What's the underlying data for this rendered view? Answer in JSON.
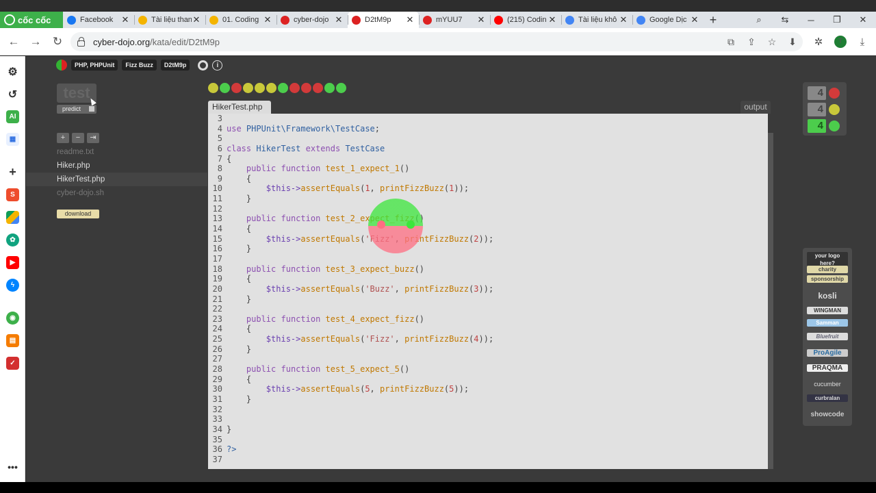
{
  "browser": {
    "brand": "cốc cốc",
    "tabs": [
      {
        "title": "Facebook",
        "icon": "facebook-icon",
        "color": "#1877f2"
      },
      {
        "title": "Tài liệu than",
        "icon": "google-drive-icon",
        "color": "#f4b400"
      },
      {
        "title": "01. Coding",
        "icon": "slides-icon",
        "color": "#f4b400"
      },
      {
        "title": "cyber-dojo",
        "icon": "cyber-dojo-icon",
        "color": "#d22"
      },
      {
        "title": "D2tM9p",
        "icon": "cyber-dojo-icon",
        "color": "#d22"
      },
      {
        "title": "mYUU7",
        "icon": "cyber-dojo-icon",
        "color": "#d22"
      },
      {
        "title": "(215) Codin",
        "icon": "youtube-icon",
        "color": "#f00"
      },
      {
        "title": "Tài liệu khô",
        "icon": "google-docs-icon",
        "color": "#4285f4"
      },
      {
        "title": "Google Dịc",
        "icon": "google-translate-icon",
        "color": "#4285f4"
      }
    ],
    "active_tab_index": 4,
    "url_host": "cyber-dojo.org",
    "url_path": "/kata/edit/D2tM9p",
    "profile_initial": "T"
  },
  "header": {
    "language": "PHP, PHPUnit",
    "exercise": "Fizz Buzz",
    "kata_id": "D2tM9p"
  },
  "controls": {
    "test_label": "test",
    "predict_label": "predict",
    "download_label": "download",
    "file_tools": [
      "+",
      "−",
      "⇥"
    ]
  },
  "files": [
    {
      "name": "readme.txt",
      "state": "dim"
    },
    {
      "name": "Hiker.php",
      "state": "normal"
    },
    {
      "name": "HikerTest.php",
      "state": "selected"
    },
    {
      "name": "cyber-dojo.sh",
      "state": "dim"
    }
  ],
  "traffic_lights": [
    "amber",
    "green",
    "red",
    "amber",
    "amber",
    "amber",
    "green",
    "red",
    "red",
    "red",
    "green",
    "green"
  ],
  "colors": {
    "green": "#4ccd4c",
    "amber": "#c8c83a",
    "red": "#d23a3a"
  },
  "editor": {
    "filename": "HikerTest.php",
    "output_label": "output",
    "lines": [
      {
        "n": "3",
        "t": ""
      },
      {
        "n": "4",
        "t": "use PHPUnit\\Framework\\TestCase;"
      },
      {
        "n": "5",
        "t": ""
      },
      {
        "n": "6",
        "t": "class HikerTest extends TestCase"
      },
      {
        "n": "7",
        "t": "{"
      },
      {
        "n": "8",
        "t": "    public function test_1_expect_1()"
      },
      {
        "n": "9",
        "t": "    {"
      },
      {
        "n": "10",
        "t": "        $this->assertEquals(1, printFizzBuzz(1));"
      },
      {
        "n": "11",
        "t": "    }"
      },
      {
        "n": "12",
        "t": ""
      },
      {
        "n": "13",
        "t": "    public function test_2_expect_fizz()"
      },
      {
        "n": "14",
        "t": "    {"
      },
      {
        "n": "15",
        "t": "        $this->assertEquals('Fizz', printFizzBuzz(2));"
      },
      {
        "n": "16",
        "t": "    }"
      },
      {
        "n": "17",
        "t": ""
      },
      {
        "n": "18",
        "t": "    public function test_3_expect_buzz()"
      },
      {
        "n": "19",
        "t": "    {"
      },
      {
        "n": "20",
        "t": "        $this->assertEquals('Buzz', printFizzBuzz(3));"
      },
      {
        "n": "21",
        "t": "    }"
      },
      {
        "n": "22",
        "t": ""
      },
      {
        "n": "23",
        "t": "    public function test_4_expect_fizz()"
      },
      {
        "n": "24",
        "t": "    {"
      },
      {
        "n": "25",
        "t": "        $this->assertEquals('Fizz', printFizzBuzz(4));"
      },
      {
        "n": "26",
        "t": "    }"
      },
      {
        "n": "27",
        "t": ""
      },
      {
        "n": "28",
        "t": "    public function test_5_expect_5()"
      },
      {
        "n": "29",
        "t": "    {"
      },
      {
        "n": "30",
        "t": "        $this->assertEquals(5, printFizzBuzz(5));"
      },
      {
        "n": "31",
        "t": "    }"
      },
      {
        "n": "32",
        "t": ""
      },
      {
        "n": "33",
        "t": ""
      },
      {
        "n": "34",
        "t": "}"
      },
      {
        "n": "35",
        "t": ""
      },
      {
        "n": "36",
        "t": "?>"
      },
      {
        "n": "37",
        "t": ""
      }
    ]
  },
  "counts": [
    {
      "value": "4",
      "color": "red"
    },
    {
      "value": "4",
      "color": "amber"
    },
    {
      "value": "4",
      "color": "green"
    }
  ],
  "sponsors": {
    "header": "your logo here?",
    "charity": "charity",
    "sponsorship": "sponsorship",
    "logos": [
      "kosli",
      "WINGMAN",
      "Samman",
      "Bluefruit",
      "ProAgile",
      "PRAQMA",
      "cucumber",
      "curbralan",
      "showcode"
    ]
  }
}
